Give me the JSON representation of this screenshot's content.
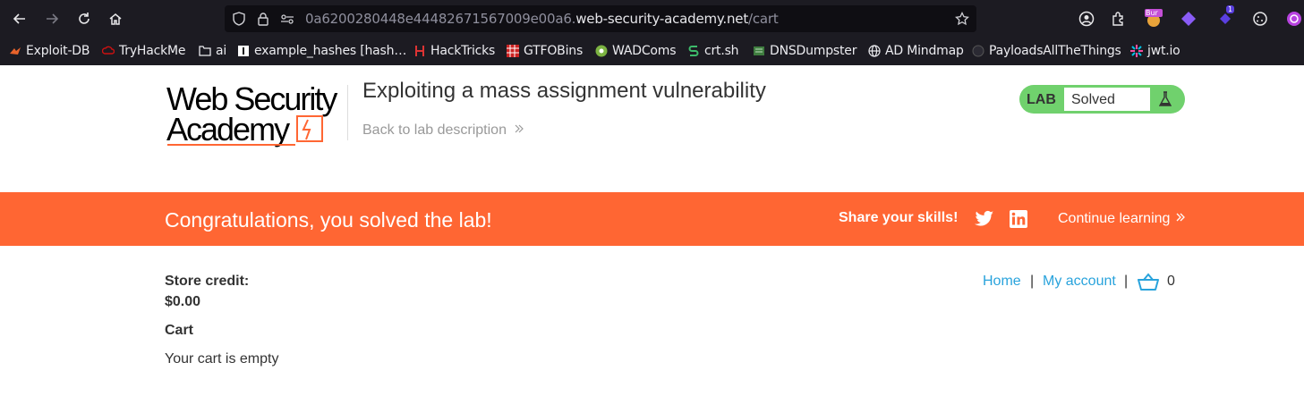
{
  "browser": {
    "url_host_prefix": "0a6200280448e44482671567009e00a6.",
    "url_domain": "web-security-academy.net",
    "url_path": "/cart",
    "burp_badge": "Bur",
    "ext_badge": "1",
    "bookmarks": [
      {
        "label": "Exploit-DB",
        "icon": "exploit-db-icon"
      },
      {
        "label": "TryHackMe",
        "icon": "tryhackme-icon"
      },
      {
        "label": "ai",
        "icon": "folder-icon"
      },
      {
        "label": "example_hashes [hash…",
        "icon": "hashcat-icon"
      },
      {
        "label": "HackTricks",
        "icon": "hacktricks-icon"
      },
      {
        "label": "GTFOBins",
        "icon": "gtfobins-icon"
      },
      {
        "label": "WADComs",
        "icon": "wadcoms-icon"
      },
      {
        "label": "crt.sh",
        "icon": "crtsh-icon"
      },
      {
        "label": "DNSDumpster",
        "icon": "dnsdumpster-icon"
      },
      {
        "label": "AD Mindmap",
        "icon": "globe-icon"
      },
      {
        "label": "PayloadsAllTheThings",
        "icon": "github-icon"
      },
      {
        "label": "jwt.io",
        "icon": "jwt-icon"
      }
    ]
  },
  "header": {
    "logo_line1": "Web Security",
    "logo_line2": "Academy",
    "title": "Exploiting a mass assignment vulnerability",
    "back_link": "Back to lab description",
    "status_lab": "LAB",
    "status_value": "Solved"
  },
  "banner": {
    "message": "Congratulations, you solved the lab!",
    "share": "Share your skills!",
    "continue": "Continue learning"
  },
  "nav": {
    "home": "Home",
    "separator": "|",
    "account": "My account",
    "cart_count": "0"
  },
  "content": {
    "credit_label": "Store credit:",
    "credit_value": "$0.00",
    "cart_heading": "Cart",
    "cart_empty": "Your cart is empty"
  },
  "colors": {
    "banner": "#ff6633",
    "status_green": "#70d16d",
    "link_blue": "#29a3dc",
    "chrome_bg": "#1c1b22"
  }
}
